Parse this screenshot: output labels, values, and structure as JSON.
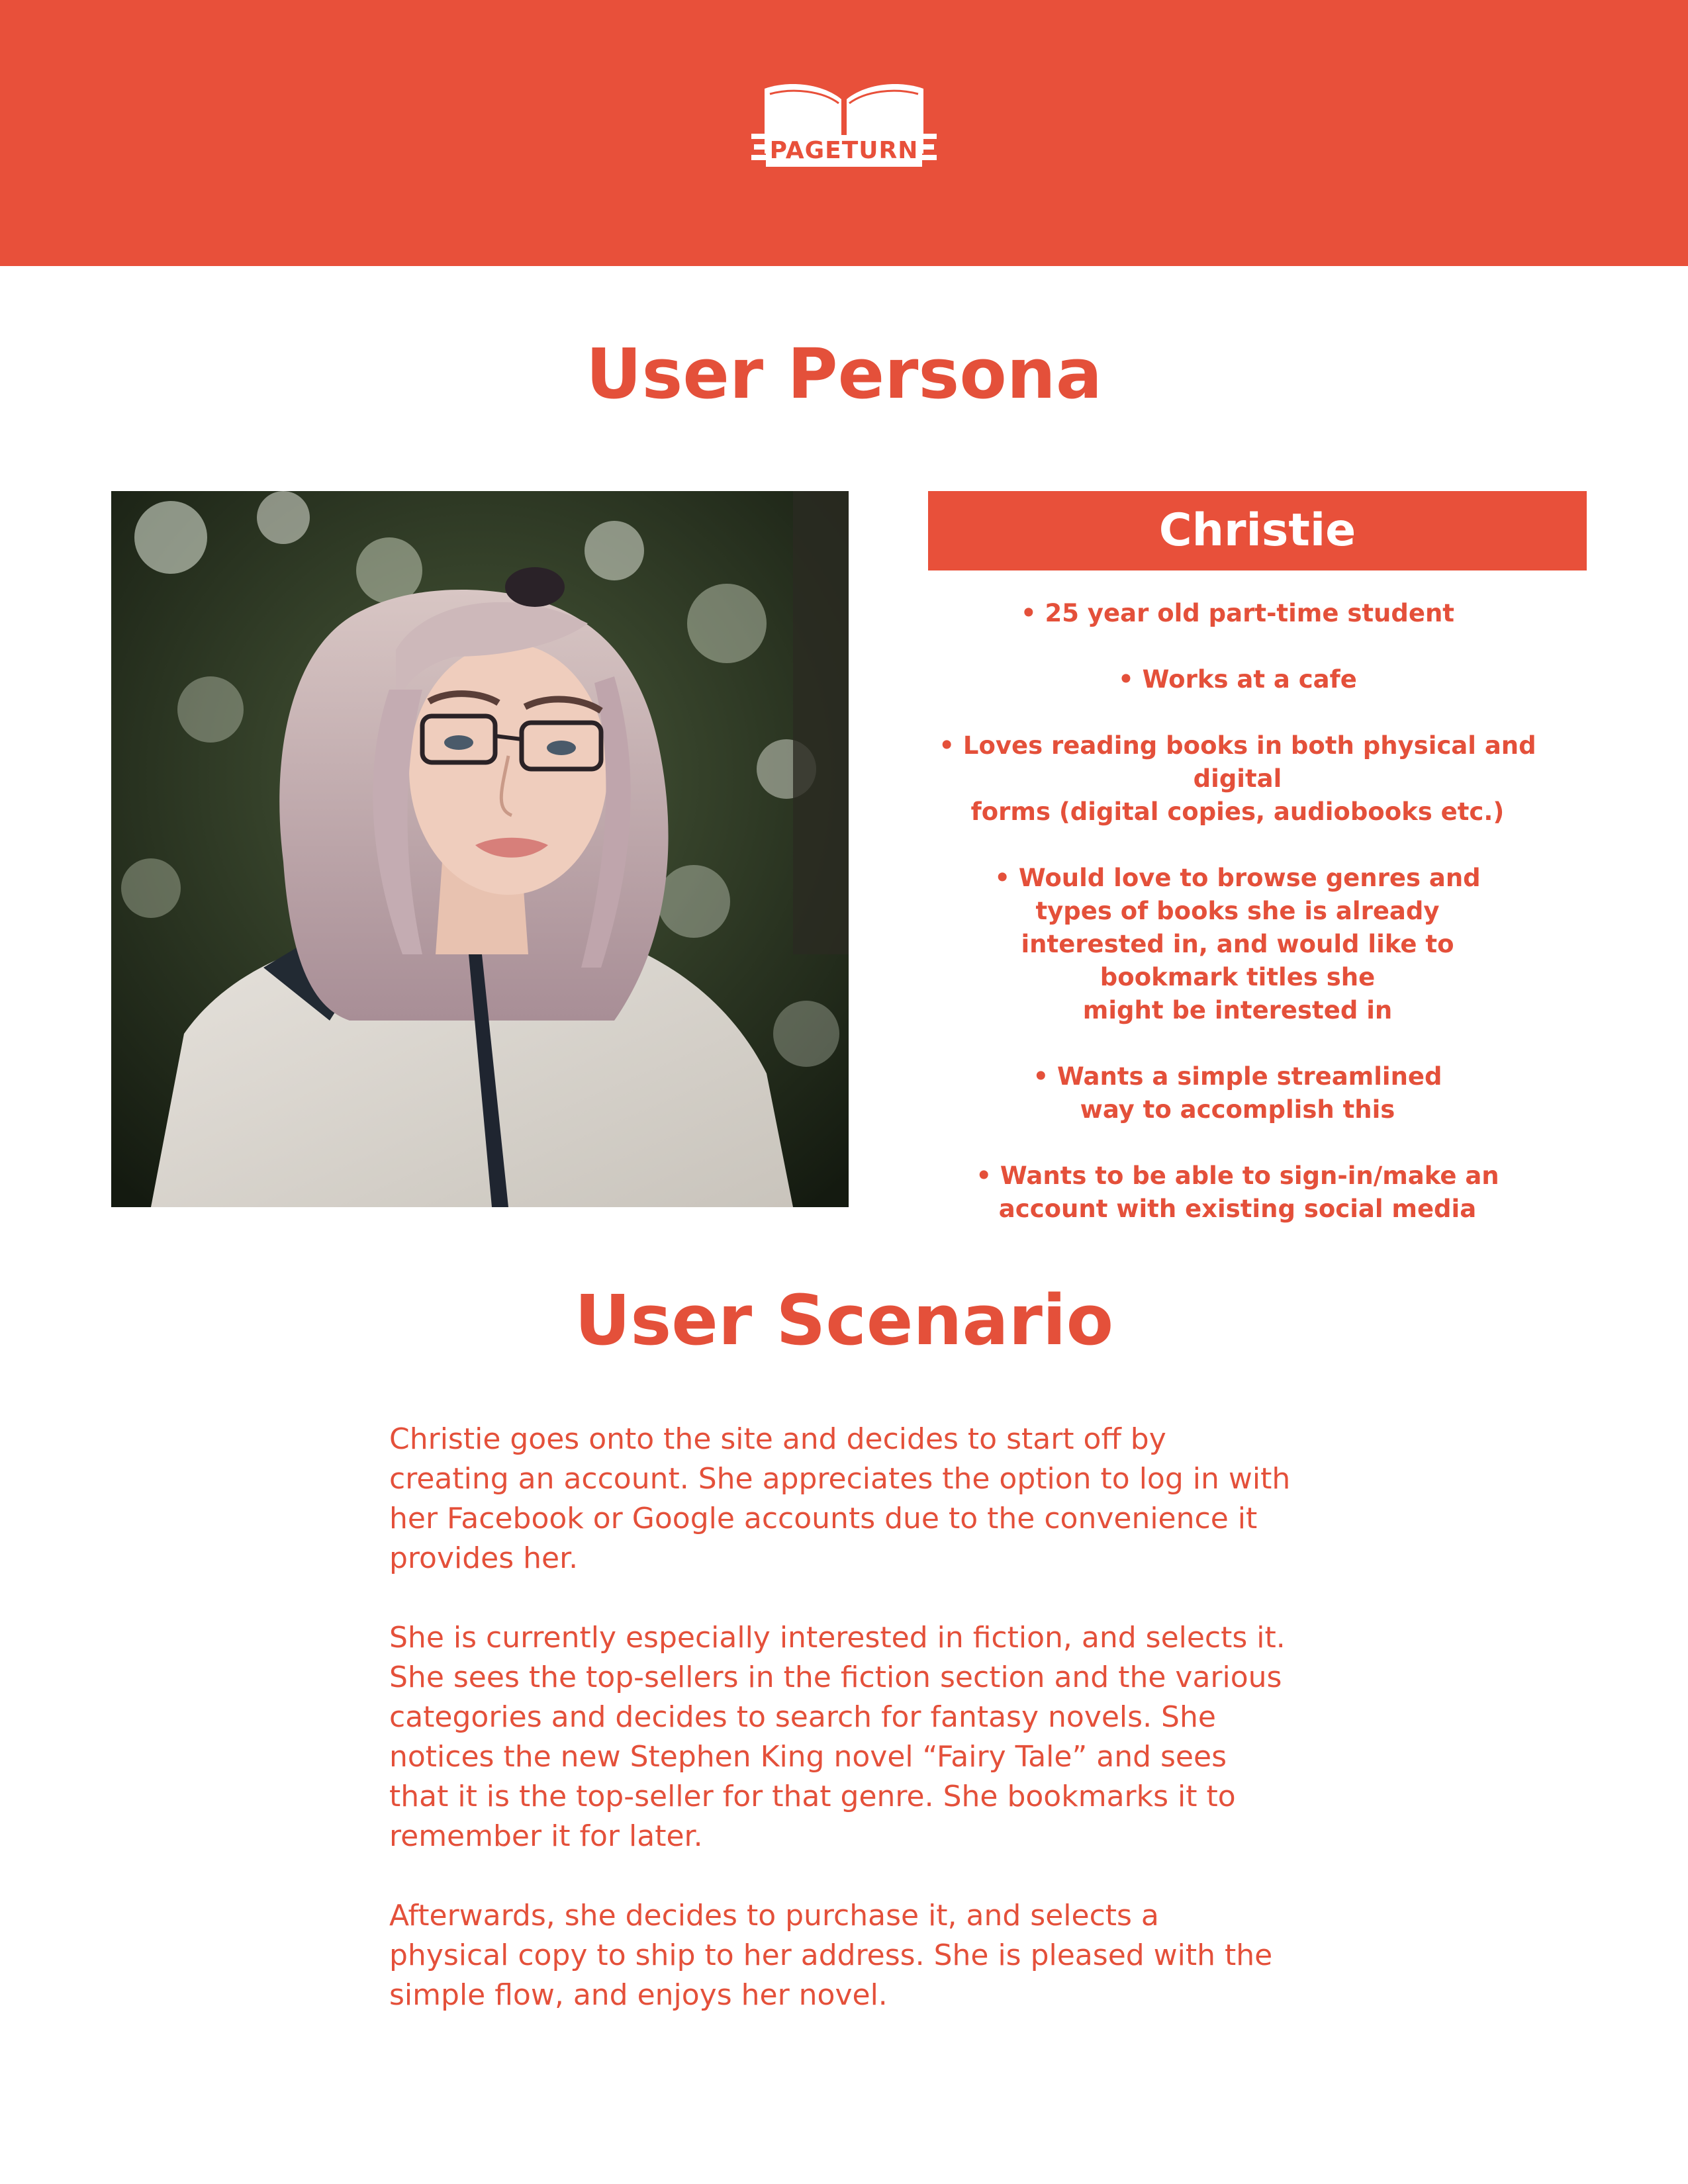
{
  "header": {
    "logo_text": "PAGETURN",
    "logo_icon": "open-book-icon",
    "background_color": "#e8503a"
  },
  "persona": {
    "title": "User Persona",
    "name": "Christie",
    "traits": [
      "• 25 year old part-time student",
      "• Works at a cafe",
      "• Loves reading books in both physical and digital\nforms (digital copies, audiobooks etc.)",
      "• Would love to browse genres and\ntypes of books she is already\ninterested in, and would like to\nbookmark titles she\nmight be interested in",
      "• Wants a simple streamlined\nway to accomplish this",
      "• Wants to be able to sign-in/make an\naccount with existing social media"
    ]
  },
  "scenario": {
    "title": "User Scenario",
    "paragraphs": [
      " Christie goes onto the site and decides to start off by\ncreating an account. She appreciates the option to log in with\nher Facebook or Google accounts due to the convenience it\nprovides her.",
      " She is currently especially interested in fiction, and selects it.\nShe sees the top-sellers in the fiction section and the various\ncategories and decides to search for fantasy novels. She\nnotices the new Stephen King novel “Fairy Tale” and sees\nthat it is the top-seller for that genre. She bookmarks it to\nremember it for later.",
      " Afterwards, she decides to purchase it, and selects a\nphysical copy to ship to her address. She is pleased with the\nsimple flow, and enjoys her novel."
    ]
  },
  "colors": {
    "accent": "#e8503a",
    "text": "#e4503a"
  }
}
